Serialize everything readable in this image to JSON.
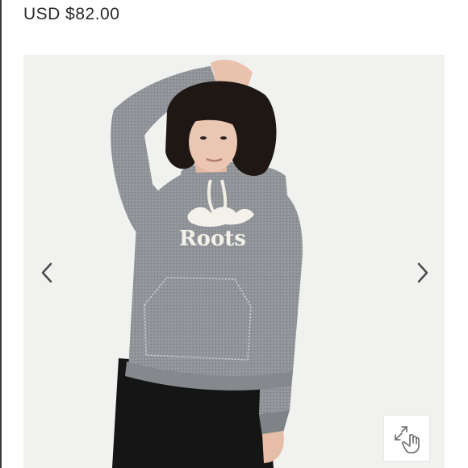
{
  "listing": {
    "price": "USD $82.00"
  },
  "gallery": {
    "image_subject": "woman wearing grey Roots hoodie and black leggings",
    "prev_icon": "chevron-left-icon",
    "next_icon": "chevron-right-icon",
    "zoom_icon": "expand-touch-icon"
  },
  "product_graphic": {
    "logo_text": "Roots"
  },
  "colors": {
    "hoodie": "#8f9296",
    "background": "#f1f1f0",
    "text": "#2b2b2b"
  }
}
